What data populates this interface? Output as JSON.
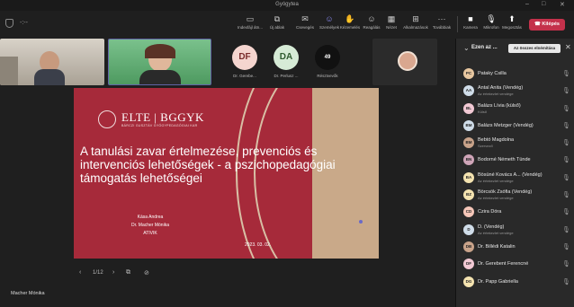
{
  "window": {
    "title": "Gyógytea"
  },
  "toolbar": {
    "timer": "-:--",
    "buttons": [
      {
        "label": "Indexfájl átn...",
        "icon": "document-icon"
      },
      {
        "label": "Új ablak",
        "icon": "new-window-icon"
      },
      {
        "label": "Csevegés",
        "icon": "chat-icon"
      },
      {
        "label": "Személyek",
        "icon": "people-icon"
      },
      {
        "label": "Kézemelés",
        "icon": "raise-hand-icon"
      },
      {
        "label": "Reagálás",
        "icon": "react-icon"
      },
      {
        "label": "Nézet",
        "icon": "grid-icon"
      },
      {
        "label": "Alkalmazások",
        "icon": "apps-icon"
      },
      {
        "label": "Továbbiak",
        "icon": "more-icon"
      },
      {
        "label": "Kamera",
        "icon": "camera-icon"
      },
      {
        "label": "Mikrofon",
        "icon": "mic-off-icon"
      },
      {
        "label": "Megosztás",
        "icon": "share-icon"
      }
    ],
    "leave_label": "Kilépés"
  },
  "gallery": {
    "tiles": [
      {
        "initials": "DF",
        "name": "Dr. Gerebe...",
        "color": "#f5d5cf"
      },
      {
        "initials": "DA",
        "name": "Dr. Perlusz ...",
        "color": "#d6ebd6"
      }
    ],
    "overflow": {
      "count": "49",
      "label": "Résztvevők"
    }
  },
  "slide": {
    "logo": "ELTE | BGGYK",
    "logo_sub": "BÁRCZI GUSZTÁV GYÓGYPEDAGÓGIAI KAR",
    "title": "A tanulási zavar értelmezése, prevenciós és intervenciós lehetőségek - a pszichopedagógiai támogatás lehetőségei",
    "authors": [
      "Kása Andrea",
      "Dr. Macher Mónika",
      "ATIVIK"
    ],
    "date": "2023. 03. 02.",
    "colors": {
      "background": "#a62a3a",
      "beige": "#c9a989"
    }
  },
  "pager": {
    "label": "1/12"
  },
  "self_name": "Macher Mónika",
  "panel": {
    "title": "Ezen az ...",
    "mute_all_label": "Az összes elnémítása",
    "participants": [
      {
        "initials": "PC",
        "name": "Pataky Csilla",
        "sub": "",
        "color": "#e8c7a0"
      },
      {
        "initials": "AA",
        "name": "Antal Anita (Vendég)",
        "sub": "Az értekezlet vendége",
        "color": "#d0dde9"
      },
      {
        "initials": "BL",
        "name": "Balázs Lívia (külső)",
        "sub": "Külső",
        "color": "#f2c9d4"
      },
      {
        "initials": "BM",
        "name": "Balázs Metzger (Vendég)",
        "sub": "",
        "color": "#d0dde9"
      },
      {
        "initials": "BM",
        "name": "Bebtó Magdolna",
        "sub": "Szervező",
        "color": "#c9a38a"
      },
      {
        "initials": "BN",
        "name": "Bodorné Németh Tünde",
        "sub": "",
        "color": "#cfa5b8"
      },
      {
        "initials": "BA",
        "name": "Bösüné Kovács A... (Vendég)",
        "sub": "Az értekezlet vendége",
        "color": "#f4e3b0"
      },
      {
        "initials": "BZ",
        "name": "Börcsök Zsófia (Vendég)",
        "sub": "Az értekezlet vendége",
        "color": "#f4e3b0"
      },
      {
        "initials": "CD",
        "name": "Czira Dóra",
        "sub": "",
        "color": "#f5c6b8"
      },
      {
        "initials": "D",
        "name": "D. (Vendég)",
        "sub": "Az értekezlet vendége",
        "color": "#d0dde9"
      },
      {
        "initials": "DB",
        "name": "Dr. Billédi Katalin",
        "sub": "",
        "color": "#c9a38a"
      },
      {
        "initials": "DF",
        "name": "Dr. Gerebent Ferencné",
        "sub": "",
        "color": "#f2c9d4"
      },
      {
        "initials": "DG",
        "name": "Dr. Papp Gabriella",
        "sub": "",
        "color": "#f4e3b0"
      }
    ]
  }
}
